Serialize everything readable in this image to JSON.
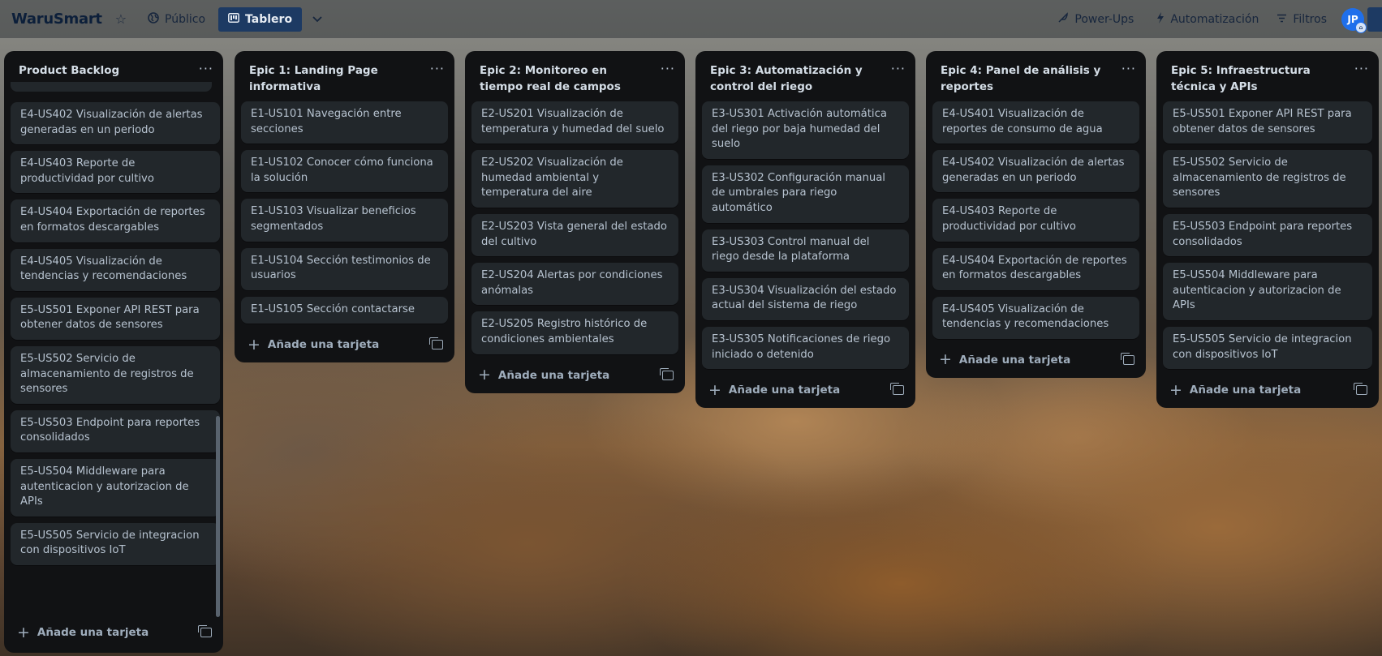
{
  "topbar": {
    "brand": "WaruSmart",
    "visibility_label": "Público",
    "view_label": "Tablero",
    "power_ups_label": "Power-Ups",
    "automation_label": "Automatización",
    "filters_label": "Filtros",
    "avatar_initials": "JP"
  },
  "common": {
    "add_card_label": "Añade una tarjeta"
  },
  "lists": [
    {
      "title": "Product Backlog",
      "cards": [
        "E4-US402 Visualización de alertas generadas en un periodo",
        "E4-US403 Reporte de productividad por cultivo",
        "E4-US404 Exportación de reportes en formatos descargables",
        "E4-US405 Visualización de tendencias y recomendaciones",
        "E5-US501 Exponer API REST para obtener datos de sensores",
        "E5-US502 Servicio de almacenamiento de registros de sensores",
        "E5-US503 Endpoint para reportes consolidados",
        "E5-US504 Middleware para autenticacion y autorizacion de APIs",
        "E5-US505 Servicio de integracion con dispositivos IoT"
      ]
    },
    {
      "title": "Epic 1: Landing Page informativa",
      "cards": [
        "E1-US101 Navegación entre secciones",
        "E1-US102 Conocer cómo funciona la solución",
        "E1-US103 Visualizar beneficios segmentados",
        "E1-US104 Sección testimonios de usuarios",
        "E1-US105 Sección contactarse"
      ]
    },
    {
      "title": "Epic 2: Monitoreo en tiempo real de campos",
      "cards": [
        "E2-US201 Visualización de temperatura y humedad del suelo",
        "E2-US202 Visualización de humedad ambiental y temperatura del aire",
        "E2-US203 Vista general del estado del cultivo",
        "E2-US204 Alertas por condiciones anómalas",
        "E2-US205 Registro histórico de condiciones ambientales"
      ]
    },
    {
      "title": "Epic 3: Automatización y control del riego",
      "cards": [
        "E3-US301 Activación automática del riego por baja humedad del suelo",
        "E3-US302 Configuración manual de umbrales para riego automático",
        "E3-US303 Control manual del riego desde la plataforma",
        "E3-US304 Visualización del estado actual del sistema de riego",
        "E3-US305 Notificaciones de riego iniciado o detenido"
      ]
    },
    {
      "title": "Epic 4: Panel de análisis y reportes",
      "cards": [
        "E4-US401 Visualización de reportes de consumo de agua",
        "E4-US402 Visualización de alertas generadas en un periodo",
        "E4-US403 Reporte de productividad por cultivo",
        "E4-US404 Exportación de reportes en formatos descargables",
        "E4-US405 Visualización de tendencias y recomendaciones"
      ]
    },
    {
      "title": "Epic 5: Infraestructura técnica y APIs",
      "cards": [
        "E5-US501 Exponer API REST para obtener datos de sensores",
        "E5-US502 Servicio de almacenamiento de registros de sensores",
        "E5-US503 Endpoint para reportes consolidados",
        "E5-US504 Middleware para autenticacion y autorizacion de APIs",
        "E5-US505 Servicio de integracion con dispositivos IoT"
      ]
    }
  ]
}
